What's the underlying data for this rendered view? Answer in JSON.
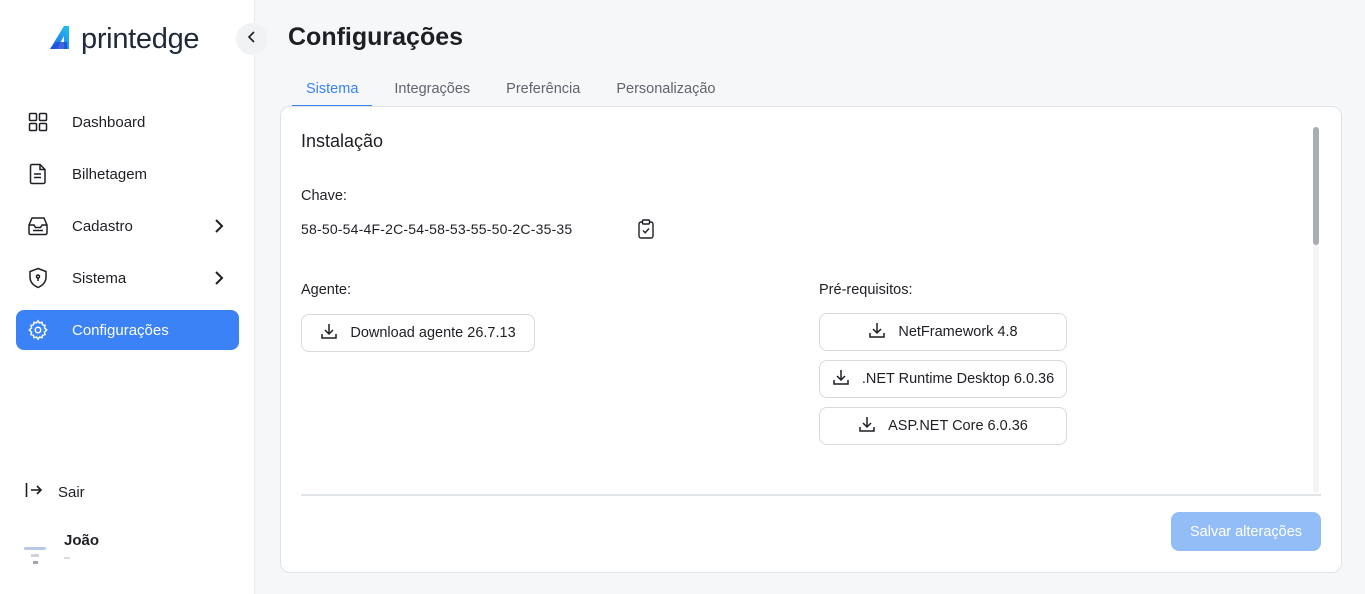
{
  "brand": {
    "name_part1": "print",
    "name_part2": "edge"
  },
  "sidebar": {
    "items": [
      {
        "label": "Dashboard"
      },
      {
        "label": "Bilhetagem"
      },
      {
        "label": "Cadastro"
      },
      {
        "label": "Sistema"
      },
      {
        "label": "Configurações"
      }
    ],
    "logout_label": "Sair",
    "user_name": "João"
  },
  "page": {
    "title": "Configurações"
  },
  "tabs": [
    {
      "label": "Sistema",
      "active": true
    },
    {
      "label": "Integrações"
    },
    {
      "label": "Preferência"
    },
    {
      "label": "Personalização"
    }
  ],
  "install": {
    "title": "Instalação",
    "key_label": "Chave:",
    "key_value": "58-50-54-4F-2C-54-58-53-55-50-2C-35-35",
    "agent_label": "Agente:",
    "agent_button": "Download agente 26.7.13",
    "prereq_label": "Pré-requisitos:",
    "prereqs": [
      {
        "label": "NetFramework 4.8"
      },
      {
        "label": ".NET Runtime Desktop 6.0.36"
      },
      {
        "label": "ASP.NET Core 6.0.36"
      }
    ]
  },
  "actions": {
    "save_label": "Salvar alterações"
  },
  "colors": {
    "accent": "#3b82f6",
    "save_disabled": "#93bdf7"
  }
}
